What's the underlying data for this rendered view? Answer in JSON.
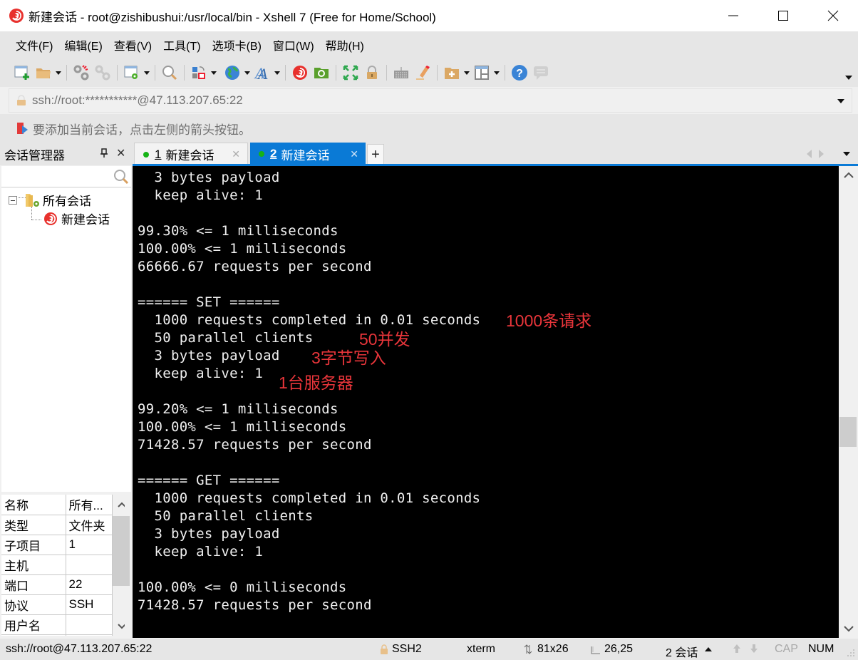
{
  "window": {
    "title": "新建会话 - root@zishibushui:/usr/local/bin - Xshell 7 (Free for Home/School)",
    "controls": [
      "minimize",
      "maximize",
      "close"
    ]
  },
  "menu": {
    "items": [
      {
        "label": "文件(F)"
      },
      {
        "label": "编辑(E)"
      },
      {
        "label": "查看(V)"
      },
      {
        "label": "工具(T)"
      },
      {
        "label": "选项卡(B)"
      },
      {
        "label": "窗口(W)"
      },
      {
        "label": "帮助(H)"
      }
    ]
  },
  "toolbar": {
    "icons": [
      "new-session-icon",
      "open-folder-icon",
      "disconnect-icon",
      "reconnect-icon",
      "session-properties-icon",
      "find-icon",
      "transfer-icon",
      "globe-icon",
      "font-icon",
      "xshell-icon",
      "xftp-icon",
      "fullscreen-icon",
      "lock-icon",
      "keyboard-icon",
      "highlight-icon",
      "new-tab-group-icon",
      "layout-icon",
      "help-icon",
      "chat-icon"
    ]
  },
  "address": {
    "value": "ssh://root:***********@47.113.207.65:22"
  },
  "hint": {
    "text": "要添加当前会话，点击左侧的箭头按钮。"
  },
  "session_manager": {
    "title": "会话管理器",
    "search_placeholder": "",
    "tree": {
      "root": "所有会话",
      "children": [
        "新建会话"
      ]
    },
    "properties": [
      {
        "key": "名称",
        "value": "所有..."
      },
      {
        "key": "类型",
        "value": "文件夹"
      },
      {
        "key": "子项目",
        "value": "1"
      },
      {
        "key": "主机",
        "value": ""
      },
      {
        "key": "端口",
        "value": "22"
      },
      {
        "key": "协议",
        "value": "SSH"
      },
      {
        "key": "用户名",
        "value": ""
      }
    ]
  },
  "tabs": [
    {
      "num": "1",
      "label": "新建会话",
      "active": false,
      "status_color": "#16b316"
    },
    {
      "num": "2",
      "label": "新建会话",
      "active": true,
      "status_color": "#16b316"
    }
  ],
  "terminal": {
    "lines": [
      "  3 bytes payload",
      "  keep alive: 1",
      "",
      "99.30% <= 1 milliseconds",
      "100.00% <= 1 milliseconds",
      "66666.67 requests per second",
      "",
      "====== SET ======",
      "  1000 requests completed in 0.01 seconds",
      "  50 parallel clients",
      "  3 bytes payload",
      "  keep alive: 1",
      "",
      "99.20% <= 1 milliseconds",
      "100.00% <= 1 milliseconds",
      "71428.57 requests per second",
      "",
      "====== GET ======",
      "  1000 requests completed in 0.01 seconds",
      "  50 parallel clients",
      "  3 bytes payload",
      "  keep alive: 1",
      "",
      "100.00% <= 0 milliseconds",
      "71428.57 requests per second"
    ],
    "annotations": [
      {
        "text": "1000条请求",
        "color": "#e8353a"
      },
      {
        "text": "50并发",
        "color": "#e8353a"
      },
      {
        "text": "3字节写入",
        "color": "#e8353a"
      },
      {
        "text": "1台服务器",
        "color": "#e8353a"
      }
    ]
  },
  "status": {
    "connection": "ssh://root@47.113.207.65:22",
    "protocol": "SSH2",
    "term_type": "xterm",
    "size": "81x26",
    "cursor": "26,25",
    "sessions": "2 会话",
    "cap": "CAP",
    "num": "NUM"
  },
  "colors": {
    "accent": "#0a7ad6",
    "annotation": "#e8353a",
    "terminal_bg": "#000000",
    "terminal_fg": "#f0f0f0"
  }
}
